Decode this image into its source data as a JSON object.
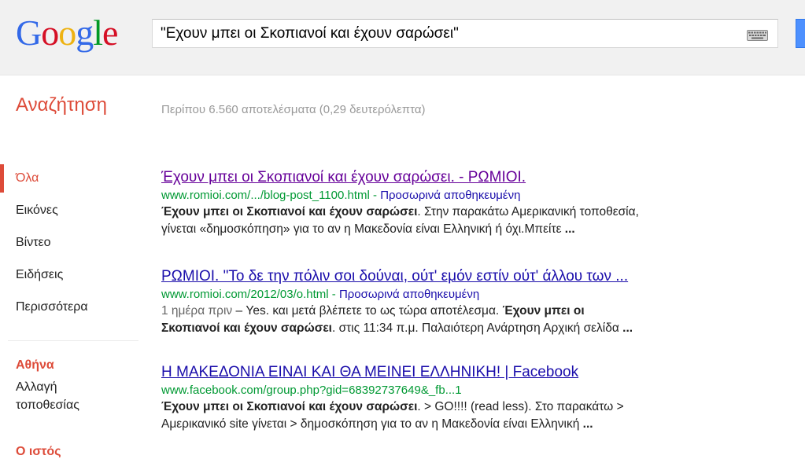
{
  "logo": {
    "text": "Google",
    "letters": [
      {
        "ch": "G",
        "color": "#3369e8"
      },
      {
        "ch": "o",
        "color": "#d50f25"
      },
      {
        "ch": "o",
        "color": "#eeb211"
      },
      {
        "ch": "g",
        "color": "#3369e8"
      },
      {
        "ch": "l",
        "color": "#009925"
      },
      {
        "ch": "e",
        "color": "#d50f25"
      }
    ]
  },
  "search": {
    "query": "\"Εχουν μπει οι Σκοπιανοί και έχουν σαρώσει\""
  },
  "header": {
    "section_title": "Αναζήτηση",
    "stats": "Περίπου 6.560 αποτελέσματα (0,29 δευτερόλεπτα)"
  },
  "nav": {
    "items": [
      {
        "label": "Όλα"
      },
      {
        "label": "Εικόνες"
      },
      {
        "label": "Βίντεο"
      },
      {
        "label": "Ειδήσεις"
      },
      {
        "label": "Περισσότερα"
      }
    ],
    "location_title": "Αθήνα",
    "location_change": "Αλλαγή τοποθεσίας",
    "more_title": "Ο ιστός"
  },
  "results": [
    {
      "title": "Έχουν μπει οι Σκοπιανοί και έχουν σαρώσει. - ΡΩΜΙΟΙ.",
      "url": "www.romioi.com/.../blog-post_1100.html",
      "sep": " - ",
      "cache": "Προσωρινά αποθηκευμένη",
      "line1_bold": "Έχουν μπει οι Σκοπιανοί και έχουν σαρώσει",
      "line1_rest": ". Στην παρακάτω Αμερικανική τοποθεσία,",
      "line2": "γίνεται «δημοσκόπηση» για το αν η Μακεδονία είναι Ελληνική ή όχι.Μπείτε ",
      "line2_end": "..."
    },
    {
      "title": "ΡΩΜΙΟΙ. \"Το δε την πόλιν σοι δούναι, ούτ' εμόν εστίν ούτ' άλλου των ...",
      "url": "www.romioi.com/2012/03/o.html",
      "sep": " - ",
      "cache": "Προσωρινά αποθηκευμένη",
      "date": "1 ημέρα πριν",
      "line1_rest": " – Yes. και μετά βλέπετε το ως τώρα αποτέλεσμα. ",
      "line1_bold": "Έχουν μπει οι",
      "line2_bold": "Σκοπιανοί και έχουν σαρώσει",
      "line2_rest": ". στις 11:34 π.μ. Παλαιότερη Ανάρτηση Αρχική σελίδα ",
      "line2_end": "..."
    },
    {
      "title": "Η ΜΑΚΕΔΟΝΙΑ ΕΙΝΑΙ ΚΑΙ ΘΑ ΜΕΙΝΕΙ ΕΛΛΗΝΙΚΗ! | Facebook",
      "url": "www.facebook.com/group.php?gid=68392737649&_fb...1",
      "line1_bold": "Έχουν μπει οι Σκοπιανοί και έχουν σαρώσει",
      "line1_rest": ". > GO!!!! (read less). Στο παρακάτω >",
      "line2": "Αμερικανικό site γίνεται > δημοσκόπηση για το αν η Μακεδονία είναι Ελληνική ",
      "line2_end": "..."
    }
  ]
}
